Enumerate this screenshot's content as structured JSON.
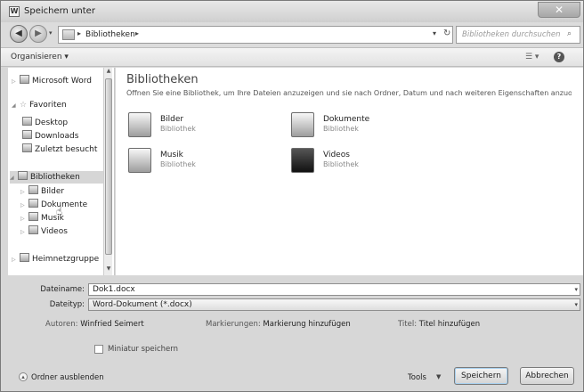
{
  "window": {
    "title": "Speichern unter",
    "app_icon_letter": "W"
  },
  "address": {
    "path": "Bibliotheken",
    "separator": "▸",
    "search_placeholder": "Bibliotheken durchsuchen"
  },
  "toolbar": {
    "organize_label": "Organisieren ▾"
  },
  "navigation": {
    "items": [
      {
        "label": "Microsoft Word",
        "icon": "word-icon",
        "level": 0
      },
      {
        "label": "Favoriten",
        "icon": "star-icon",
        "level": 0
      },
      {
        "label": "Desktop",
        "icon": "desktop-icon",
        "level": 1
      },
      {
        "label": "Downloads",
        "icon": "downloads-icon",
        "level": 1
      },
      {
        "label": "Zuletzt besucht",
        "icon": "recent-icon",
        "level": 1
      },
      {
        "label": "Bibliotheken",
        "icon": "library-icon",
        "level": 0,
        "selected": true
      },
      {
        "label": "Bilder",
        "icon": "pictures-icon",
        "level": 1
      },
      {
        "label": "Dokumente",
        "icon": "documents-icon",
        "level": 1
      },
      {
        "label": "Musik",
        "icon": "music-icon",
        "level": 1
      },
      {
        "label": "Videos",
        "icon": "videos-icon",
        "level": 1
      },
      {
        "label": "Heimnetzgruppe",
        "icon": "homegroup-icon",
        "level": 0
      }
    ]
  },
  "main": {
    "title": "Bibliotheken",
    "description": "Öffnen Sie eine Bibliothek, um Ihre Dateien anzuzeigen und sie nach Ordner, Datum und nach weiteren Eigenschaften anzuordn...",
    "libraries": [
      {
        "name": "Bilder",
        "type": "Bibliothek",
        "icon": "pictures-library-icon"
      },
      {
        "name": "Dokumente",
        "type": "Bibliothek",
        "icon": "documents-library-icon"
      },
      {
        "name": "Musik",
        "type": "Bibliothek",
        "icon": "music-library-icon"
      },
      {
        "name": "Videos",
        "type": "Bibliothek",
        "icon": "videos-library-icon"
      }
    ]
  },
  "form": {
    "filename_label": "Dateiname:",
    "filename_value": "Dok1.docx",
    "filetype_label": "Dateityp:",
    "filetype_value": "Word-Dokument (*.docx)",
    "authors_label": "Autoren:",
    "authors_value": "Winfried Seimert",
    "tags_label": "Markierungen:",
    "tags_value": "Markierung hinzufügen",
    "title_label": "Titel:",
    "title_value": "Titel hinzufügen",
    "thumbnail_label": "Miniatur speichern",
    "hide_folders_label": "Ordner ausblenden",
    "tools_label": "Tools",
    "save_label": "Speichern",
    "cancel_label": "Abbrechen"
  }
}
